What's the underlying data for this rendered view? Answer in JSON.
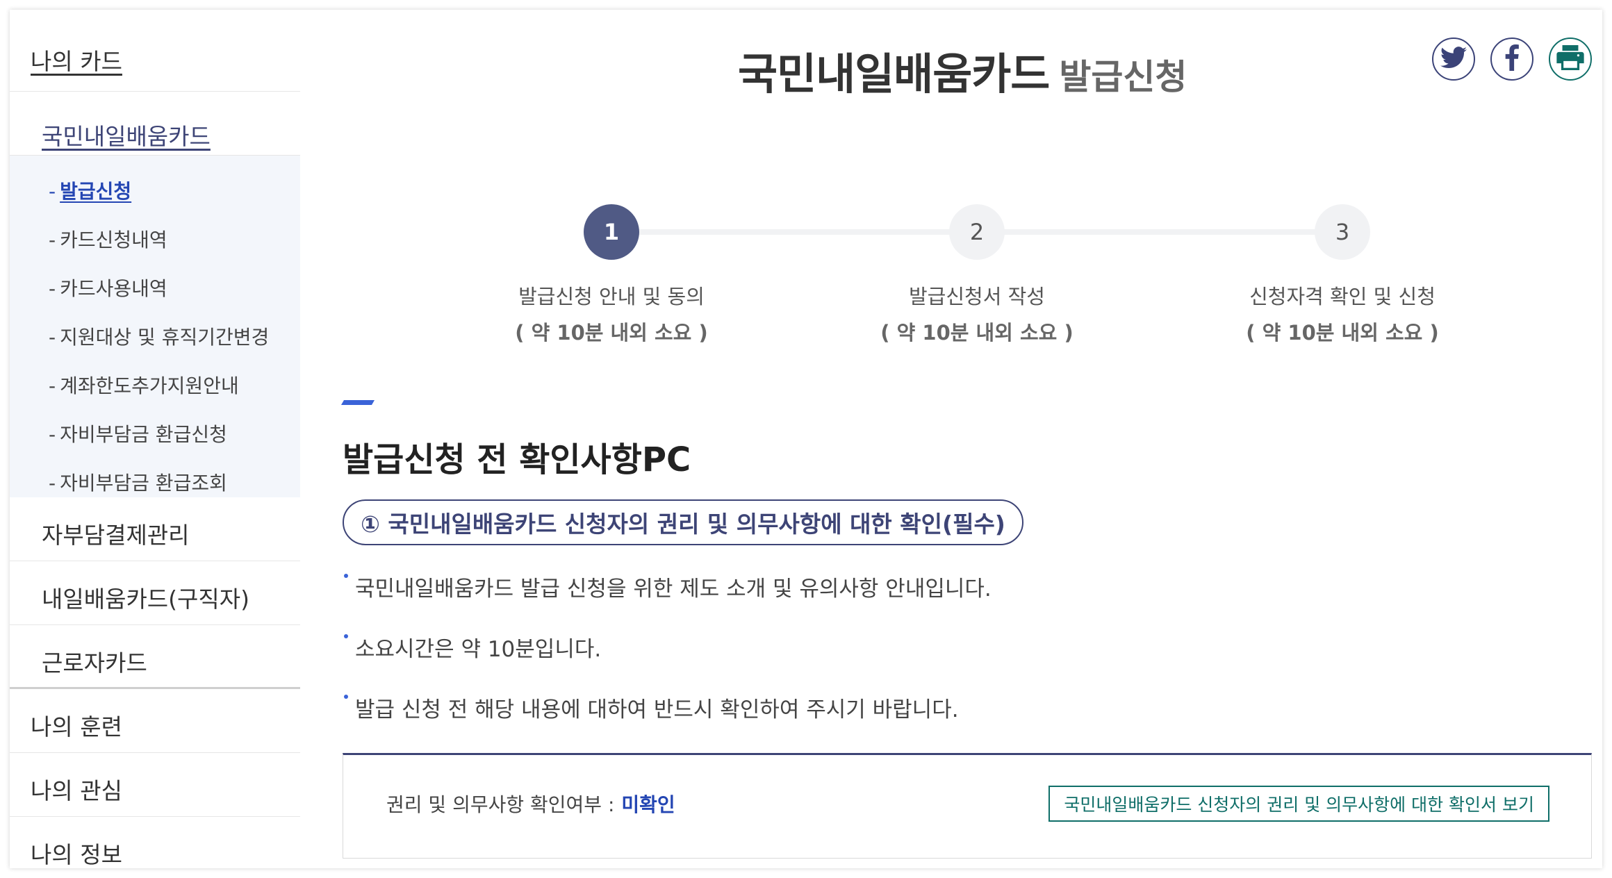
{
  "sidebar": {
    "top": "나의 카드",
    "card": "국민내일배움카드",
    "sub_items": [
      {
        "label": "발급신청",
        "active": true
      },
      {
        "label": "카드신청내역"
      },
      {
        "label": "카드사용내역"
      },
      {
        "label": "지원대상 및 휴직기간변경"
      },
      {
        "label": "계좌한도추가지원안내"
      },
      {
        "label": "자비부담금 환급신청"
      },
      {
        "label": "자비부담금 환급조회"
      }
    ],
    "level2": [
      "자부담결제관리",
      "내일배움카드(구직자)",
      "근로자카드"
    ],
    "level1": [
      "나의 훈련",
      "나의 관심",
      "나의 정보"
    ]
  },
  "header": {
    "title_main": "국민내일배움카드",
    "title_sub": "발급신청",
    "share_icons": [
      "twitter-icon",
      "facebook-icon",
      "print-icon"
    ]
  },
  "steps": [
    {
      "num": "1",
      "title": "발급신청 안내 및 동의",
      "duration": "( 약 10분 내외 소요 )",
      "active": true
    },
    {
      "num": "2",
      "title": "발급신청서 작성",
      "duration": "( 약 10분 내외 소요 )"
    },
    {
      "num": "3",
      "title": "신청자격 확인 및 신청",
      "duration": "( 약 10분 내외 소요 )"
    }
  ],
  "section": {
    "title": "발급신청 전 확인사항PC",
    "pill": "① 국민내일배움카드 신청자의 권리 및 의무사항에 대한 확인(필수)",
    "bullets": [
      "국민내일배움카드 발급 신청을 위한 제도 소개 및 유의사항 안내입니다.",
      "소요시간은 약 10분입니다.",
      "발급 신청 전 해당 내용에 대하여 반드시 확인하여 주시기 바랍니다."
    ]
  },
  "confirm": {
    "label": "권리 및 의무사항 확인여부 :",
    "status": "미확인",
    "button": "국민내일배움카드 신청자의 권리 및 의무사항에 대한 확인서 보기"
  },
  "colors": {
    "navy": "#3d4476",
    "step_active": "#505a85",
    "link_blue": "#2446b3",
    "accent_blue": "#3a63d8",
    "teal": "#0f6e68"
  }
}
